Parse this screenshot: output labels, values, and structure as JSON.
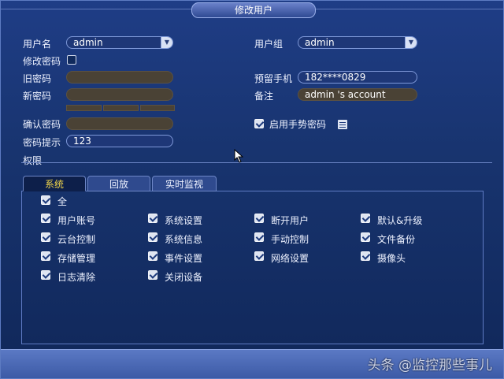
{
  "dialog": {
    "title": "修改用户"
  },
  "form": {
    "username_label": "用户名",
    "username_value": "admin",
    "change_password_label": "修改密码",
    "change_password_checked": false,
    "old_password_label": "旧密码",
    "new_password_label": "新密码",
    "confirm_password_label": "确认密码",
    "password_hint_label": "密码提示",
    "password_hint_value": "123",
    "group_label": "用户组",
    "group_value": "admin",
    "phone_label": "预留手机",
    "phone_value": "182****0829",
    "note_label": "备注",
    "note_value": "admin 's account",
    "gesture_label": "启用手势密码",
    "gesture_checked": true
  },
  "permissions": {
    "section_label": "权限",
    "tabs": [
      {
        "label": "系统",
        "active": true
      },
      {
        "label": "回放",
        "active": false
      },
      {
        "label": "实时监视",
        "active": false
      }
    ],
    "all_label": "全",
    "items": [
      "用户账号",
      "系统设置",
      "断开用户",
      "默认&升级",
      "云台控制",
      "系统信息",
      "手动控制",
      "文件备份",
      "存储管理",
      "事件设置",
      "网络设置",
      "摄像头",
      "日志清除",
      "关闭设备"
    ]
  },
  "watermark": "头条 @监控那些事儿"
}
